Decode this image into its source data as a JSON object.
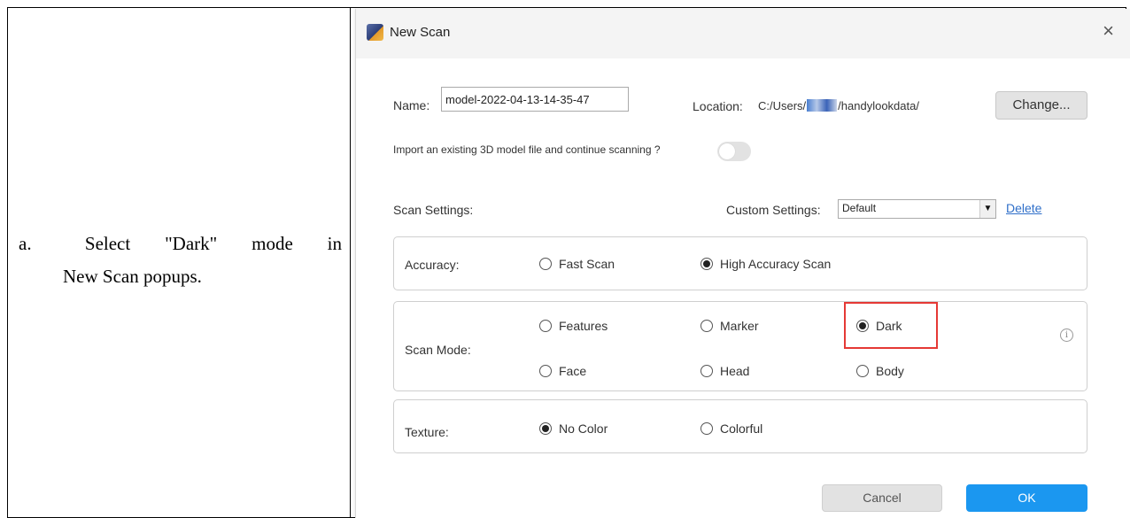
{
  "instruction": {
    "marker": "a.",
    "line1_words": [
      "Select",
      "\"Dark\"",
      "mode",
      "in"
    ],
    "line2": "New Scan popups."
  },
  "dialog": {
    "title": "New Scan",
    "close_glyph": "×",
    "icon": "app-icon",
    "name_label": "Name:",
    "name_value": "model-2022-04-13-14-35-47",
    "location_label": "Location:",
    "location_prefix": "C:/Users/",
    "location_suffix": "/handylookdata/",
    "change_label": "Change...",
    "import_text": "Import an existing 3D model file and continue scanning ?",
    "import_toggle_on": false,
    "scan_settings_label": "Scan Settings:",
    "custom_settings_label": "Custom Settings:",
    "custom_settings_value": "Default",
    "delete_label": "Delete",
    "accuracy": {
      "label": "Accuracy:",
      "options": [
        {
          "label": "Fast Scan",
          "selected": false
        },
        {
          "label": "High Accuracy Scan",
          "selected": true
        }
      ]
    },
    "scan_mode": {
      "label": "Scan Mode:",
      "options": [
        {
          "label": "Features",
          "selected": false
        },
        {
          "label": "Marker",
          "selected": false
        },
        {
          "label": "Dark",
          "selected": true
        },
        {
          "label": "Face",
          "selected": false
        },
        {
          "label": "Head",
          "selected": false
        },
        {
          "label": "Body",
          "selected": false
        }
      ]
    },
    "texture": {
      "label": "Texture:",
      "options": [
        {
          "label": "No Color",
          "selected": true
        },
        {
          "label": "Colorful",
          "selected": false
        }
      ]
    },
    "cancel_label": "Cancel",
    "ok_label": "OK",
    "colors": {
      "ok": "#1b97f0",
      "highlight": "#e53935",
      "link": "#2f6fc9"
    }
  }
}
